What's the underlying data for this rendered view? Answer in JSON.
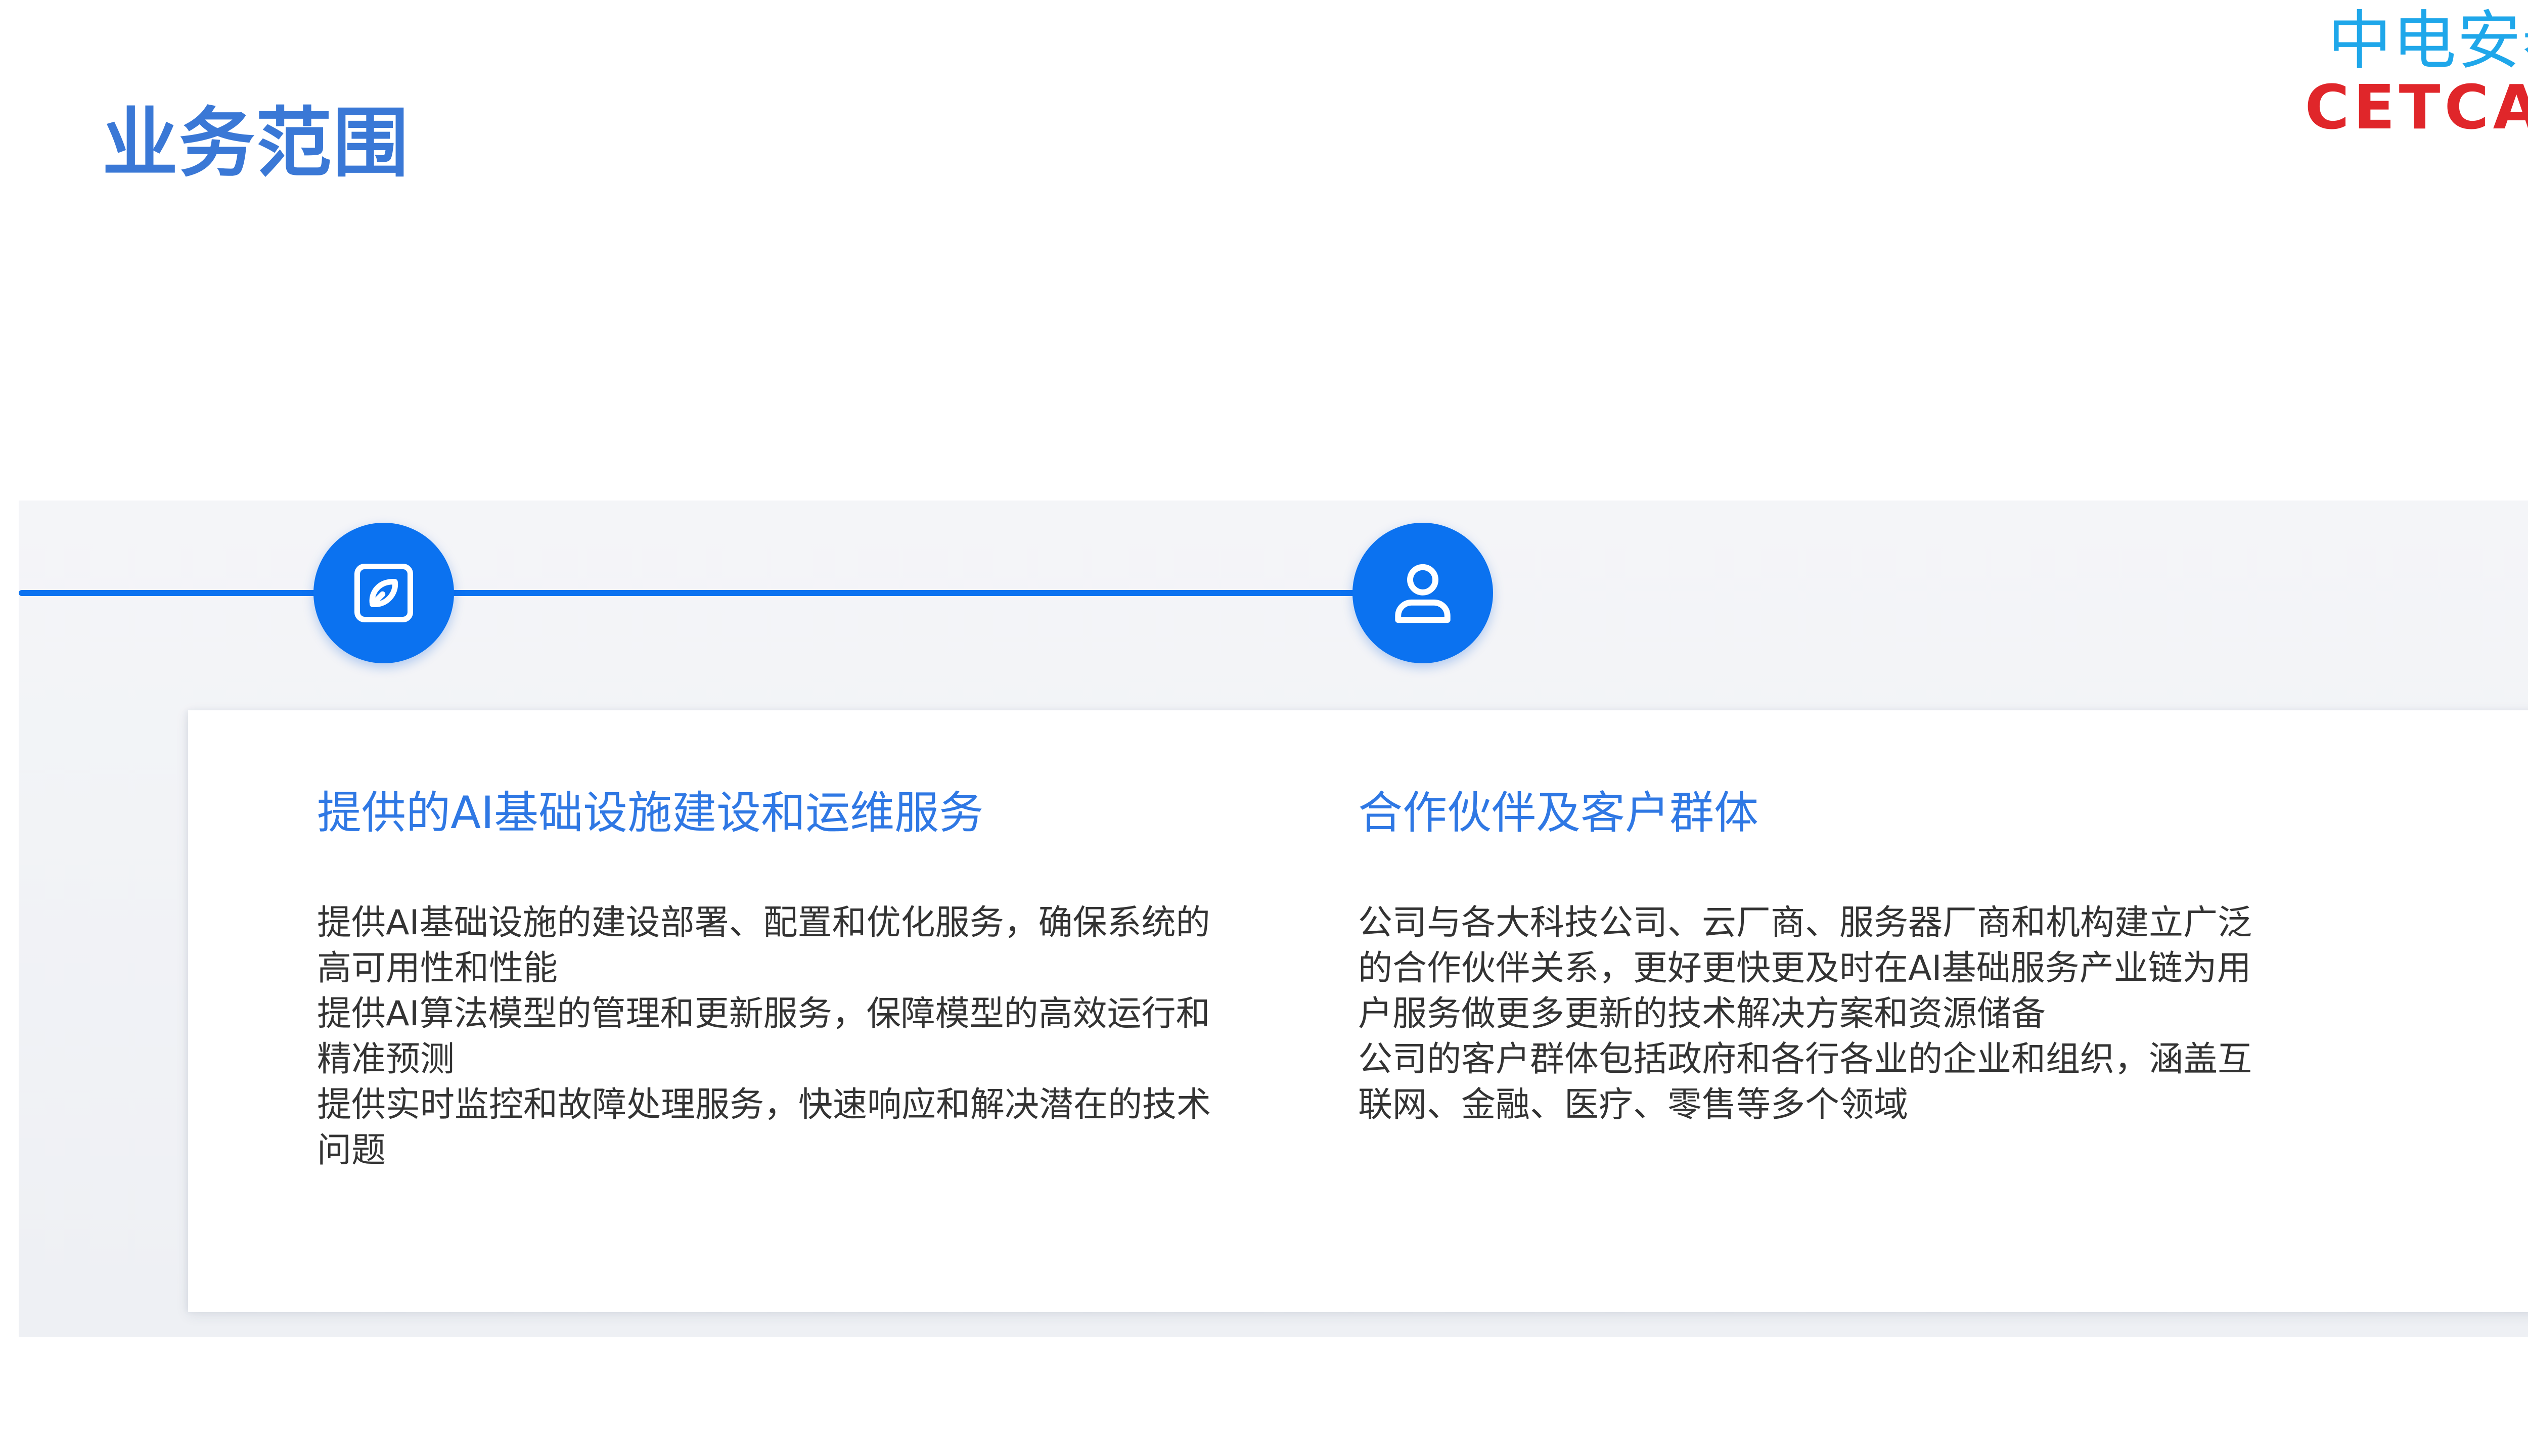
{
  "page": {
    "title": "业务范围"
  },
  "logo": {
    "cn_text": "中电安泰",
    "en_text": "CETCAT"
  },
  "icons": {
    "node1": "edit-pen-icon",
    "node2": "user-icon"
  },
  "colors": {
    "title_blue": "#3a78d6",
    "accent_blue": "#0b72f0",
    "heading_blue": "#2f78e4",
    "body_text": "#333333",
    "logo_cyan": "#1fa7ea",
    "logo_red": "#e0262a"
  },
  "sections": [
    {
      "heading": "提供的AI基础设施建设和运维服务",
      "paragraphs": [
        "提供AI基础设施的建设部署、配置和优化服务，确保系统的高可用性和性能",
        "提供AI算法模型的管理和更新服务，保障模型的高效运行和精准预测",
        "提供实时监控和故障处理服务，快速响应和解决潜在的技术问题"
      ]
    },
    {
      "heading": "合作伙伴及客户群体",
      "paragraphs": [
        "公司与各大科技公司、云厂商、服务器厂商和机构建立广泛的合作伙伴关系，更好更快更及时在AI基础服务产业链为用户服务做更多更新的技术解决方案和资源储备",
        "公司的客户群体包括政府和各行各业的企业和组织，涵盖互联网、金融、医疗、零售等多个领域"
      ]
    }
  ]
}
